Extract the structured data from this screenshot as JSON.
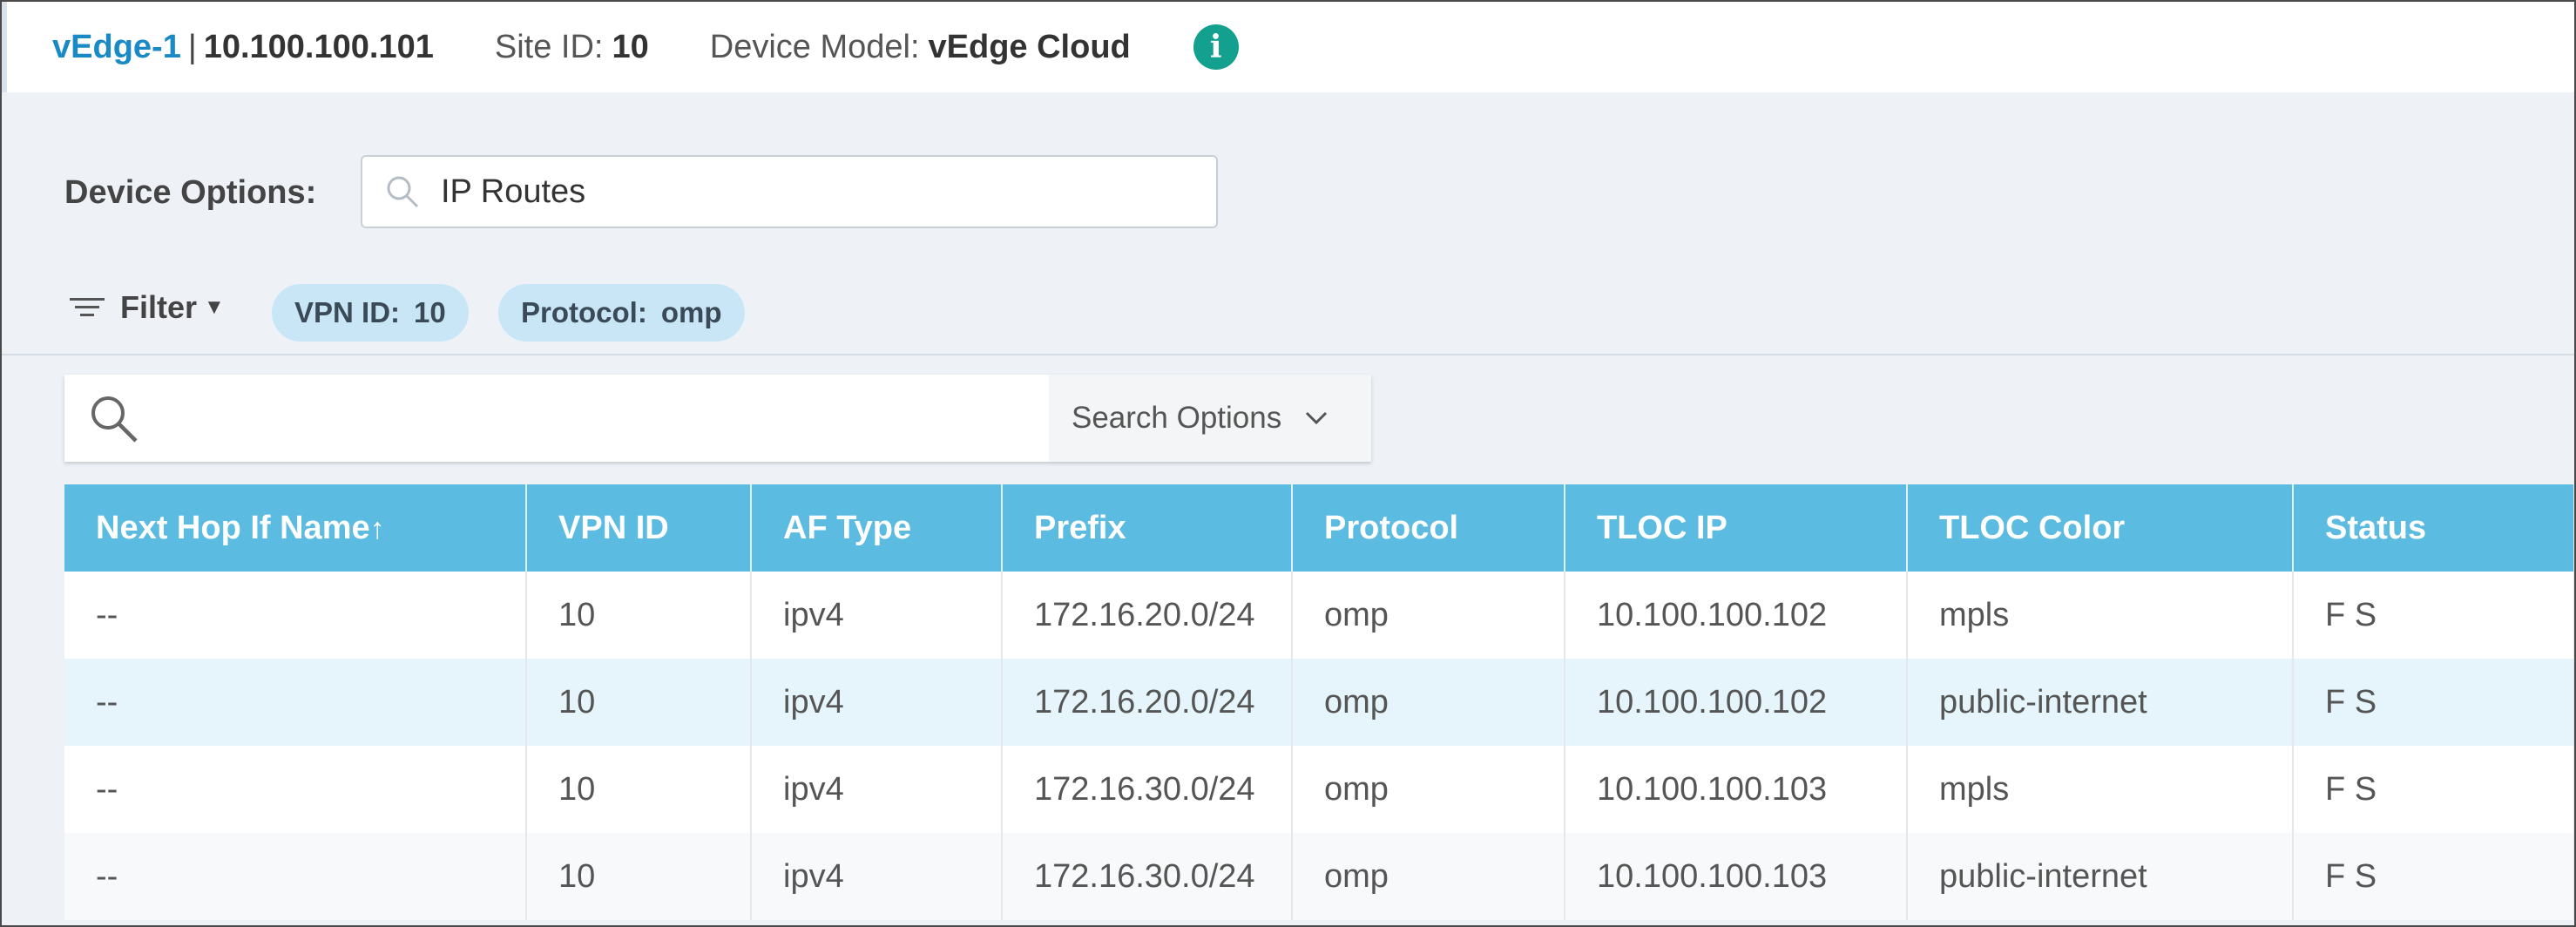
{
  "header": {
    "device_name": "vEdge-1",
    "separator": "|",
    "device_ip": "10.100.100.101",
    "site_label": "Site ID:",
    "site_value": "10",
    "model_label": "Device Model:",
    "model_value": "vEdge Cloud",
    "info_glyph": "i"
  },
  "device_options": {
    "label": "Device Options:",
    "value": "IP Routes"
  },
  "filter": {
    "label": "Filter",
    "chips": [
      {
        "label": "VPN ID:",
        "value": "10"
      },
      {
        "label": "Protocol:",
        "value": "omp"
      }
    ]
  },
  "search": {
    "placeholder": "",
    "options_label": "Search Options"
  },
  "table": {
    "columns": [
      "Next Hop If Name",
      "VPN ID",
      "AF Type",
      "Prefix",
      "Protocol",
      "TLOC IP",
      "TLOC Color",
      "Status"
    ],
    "sort_indicator": "↑",
    "rows": [
      [
        "--",
        "10",
        "ipv4",
        "172.16.20.0/24",
        "omp",
        "10.100.100.102",
        "mpls",
        "F S"
      ],
      [
        "--",
        "10",
        "ipv4",
        "172.16.20.0/24",
        "omp",
        "10.100.100.102",
        "public-internet",
        "F S"
      ],
      [
        "--",
        "10",
        "ipv4",
        "172.16.30.0/24",
        "omp",
        "10.100.100.103",
        "mpls",
        "F S"
      ],
      [
        "--",
        "10",
        "ipv4",
        "172.16.30.0/24",
        "omp",
        "10.100.100.103",
        "public-internet",
        "F S"
      ]
    ]
  },
  "colors": {
    "accent": "#1a8ac6",
    "table_header": "#5bbbe0",
    "chip": "#c9e6f6",
    "info_icon": "#13a08f"
  }
}
